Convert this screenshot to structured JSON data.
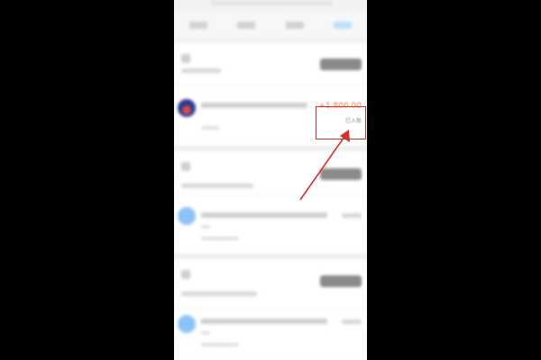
{
  "record": {
    "amount": "+1,800.00",
    "status": "已入账"
  },
  "annotation": {
    "color": "#d0312d"
  },
  "colors": {
    "amount": "#f07a5a",
    "active_tab": "#bfe0ff"
  }
}
